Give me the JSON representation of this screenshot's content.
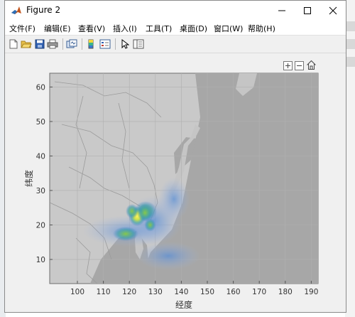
{
  "window": {
    "title": "Figure 2"
  },
  "menu": [
    {
      "label": "文件(F)"
    },
    {
      "label": "编辑(E)"
    },
    {
      "label": "查看(V)"
    },
    {
      "label": "插入(I)"
    },
    {
      "label": "工具(T)"
    },
    {
      "label": "桌面(D)"
    },
    {
      "label": "窗口(W)"
    },
    {
      "label": "帮助(H)"
    }
  ],
  "toolbar": [
    "new-figure-icon",
    "open-folder-icon",
    "save-icon",
    "print-icon",
    "link-plot-icon",
    "colorbar-icon",
    "legend-icon",
    "pointer-icon",
    "property-inspector-icon"
  ],
  "axes_toolbar": [
    "zoom-in-icon",
    "zoom-out-icon",
    "home-icon"
  ],
  "chart_data": {
    "type": "heatmap",
    "title": "",
    "xlabel": "经度",
    "ylabel": "纬度",
    "xlim": [
      92,
      136
    ],
    "ylim": [
      3,
      64
    ],
    "xticks": [
      100,
      110,
      120,
      130,
      140,
      150,
      160,
      170,
      180,
      190
    ],
    "xtick_labels": [
      "100",
      "110",
      "120",
      "130",
      "140",
      "150",
      "160",
      "170",
      "180",
      "190"
    ],
    "yticks": [
      10,
      20,
      30,
      40,
      50,
      60
    ],
    "ytick_labels": [
      "10",
      "20",
      "30",
      "40",
      "50",
      "60"
    ],
    "grid": true,
    "colors": {
      "land": "#d4d4d4",
      "ocean": "#a9a9a9",
      "border": "#9a9a9a",
      "axis_bg": "#c8c8c8"
    },
    "hotspots": [
      {
        "lon": 123,
        "lat": 22.5,
        "intensity": 1.0
      },
      {
        "lon": 126,
        "lat": 23.5,
        "intensity": 0.85
      },
      {
        "lon": 121,
        "lat": 24,
        "intensity": 0.6
      },
      {
        "lon": 128,
        "lat": 20,
        "intensity": 0.5
      }
    ]
  }
}
